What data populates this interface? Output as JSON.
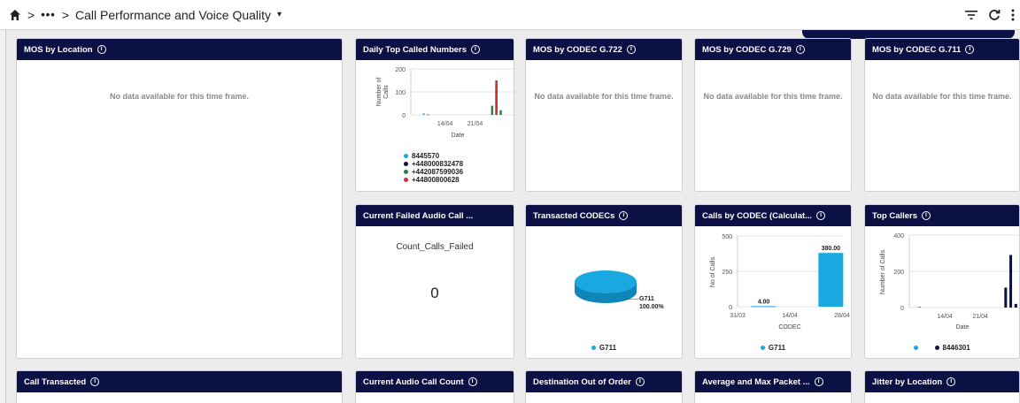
{
  "topbar": {
    "more": "•••",
    "title": "Call Performance and Voice Quality",
    "caret": "▾"
  },
  "cards": {
    "mos_location": {
      "title": "MOS by Location",
      "message": "No data available for this time frame."
    },
    "top_called": {
      "title": "Daily Top Called Numbers",
      "legend": [
        {
          "label": "8445570",
          "color": "#1aa8e0"
        },
        {
          "label": "+448000832478",
          "color": "#0b1145"
        },
        {
          "label": "+442087599036",
          "color": "#2e7d4e"
        },
        {
          "label": "+44800800628",
          "color": "#d32f2f"
        }
      ]
    },
    "g722": {
      "title": "MOS by CODEC G.722",
      "message": "No data available for this time frame."
    },
    "g729": {
      "title": "MOS by CODEC G.729",
      "message": "No data available for this time frame."
    },
    "g711": {
      "title": "MOS by CODEC G.711",
      "message": "No data available for this time frame."
    },
    "failed": {
      "title": "Current Failed Audio Call ...",
      "label": "Count_Calls_Failed",
      "value": "0"
    },
    "transacted_codecs": {
      "title": "Transacted CODECs",
      "legend": "G711",
      "legend_color": "#1aa8e0"
    },
    "calls_by_codec": {
      "title": "Calls by CODEC (Calculat...",
      "legend": "G711",
      "legend_color": "#1aa8e0"
    },
    "top_callers": {
      "title": "Top Callers",
      "legend": [
        {
          "label": "",
          "color": "#1aa8e0"
        },
        {
          "label": "8446301",
          "color": "#0b1145"
        }
      ]
    },
    "call_transacted": {
      "title": "Call Transacted"
    },
    "audio_count": {
      "title": "Current Audio Call Count"
    },
    "out_of_order": {
      "title": "Destination Out of Order"
    },
    "packet": {
      "title": "Average and Max Packet ..."
    },
    "jitter": {
      "title": "Jitter by Location"
    }
  },
  "chart_data": [
    {
      "type": "bar",
      "title": "Daily Top Called Numbers",
      "xlabel": "Date",
      "ylabel": "Number of Calls",
      "ylim": [
        0,
        200
      ],
      "yticks": [
        "0",
        "100",
        "200"
      ],
      "xticks": [
        "14/04",
        "21/04"
      ],
      "series": [
        {
          "name": "8445570",
          "color": "#1aa8e0",
          "points": [
            [
              "09/04",
              6
            ],
            [
              "10/04",
              3
            ]
          ]
        },
        {
          "name": "+448000832478",
          "color": "#0b1145",
          "points": [
            [
              "26/04",
              125
            ]
          ]
        },
        {
          "name": "+442087599036",
          "color": "#2e7d4e",
          "points": [
            [
              "25/04",
              40
            ],
            [
              "26/04",
              150
            ],
            [
              "27/04",
              20
            ]
          ]
        },
        {
          "name": "+44800800628",
          "color": "#d32f2f",
          "points": [
            [
              "26/04",
              145
            ]
          ]
        }
      ]
    },
    {
      "type": "pie",
      "title": "Transacted CODECs",
      "slices": [
        {
          "label": "G711",
          "value": 100.0,
          "color": "#1aa8e0"
        }
      ],
      "slice_label": "G711",
      "slice_value_label": "100.00%"
    },
    {
      "type": "bar",
      "title": "Calls by CODEC (Calculat...",
      "xlabel": "CODEC",
      "ylabel": "No of Calls",
      "ylim": [
        0,
        500
      ],
      "yticks": [
        "0",
        "250",
        "500"
      ],
      "xticks": [
        "31/03",
        "14/04",
        "28/04"
      ],
      "series": [
        {
          "name": "G711",
          "color": "#1aa8e0",
          "points": [
            [
              "07/04",
              4.0
            ],
            [
              "25/04",
              380.0
            ]
          ],
          "labels": [
            "4.00",
            "380.00"
          ]
        }
      ]
    },
    {
      "type": "bar",
      "title": "Top Callers",
      "xlabel": "Date",
      "ylabel": "Number of Calls",
      "ylim": [
        0,
        400
      ],
      "yticks": [
        "0",
        "200",
        "400"
      ],
      "xticks": [
        "14/04",
        "21/04"
      ],
      "series": [
        {
          "name": "",
          "color": "#1aa8e0",
          "points": [
            [
              "09/04",
              5
            ]
          ]
        },
        {
          "name": "8446301",
          "color": "#0b1145",
          "points": [
            [
              "26/04",
              110
            ],
            [
              "27/04",
              290
            ],
            [
              "28/04",
              20
            ]
          ]
        }
      ]
    }
  ]
}
